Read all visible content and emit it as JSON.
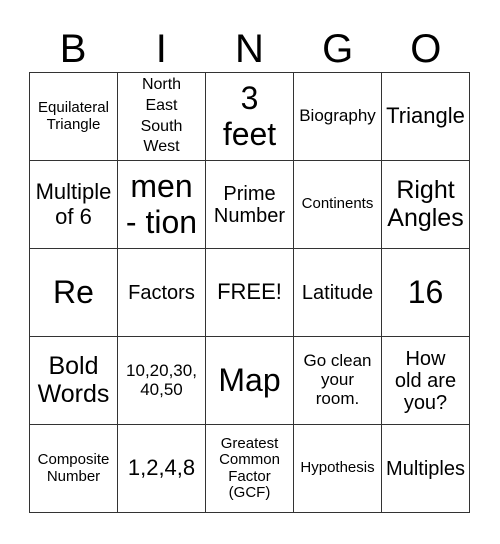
{
  "header": [
    "B",
    "I",
    "N",
    "G",
    "O"
  ],
  "rows": [
    [
      "Equilateral\nTriangle",
      "North\nEast\nSouth\nWest",
      "3\nfeet",
      "Biography",
      "Triangle"
    ],
    [
      "Multiple\nof 6",
      "men\n- tion",
      "Prime\nNumber",
      "Continents",
      "Right\nAngles"
    ],
    [
      "Re",
      "Factors",
      "FREE!",
      "Latitude",
      "16"
    ],
    [
      "Bold\nWords",
      "10,20,30,\n40,50",
      "Map",
      "Go clean\nyour\nroom.",
      "How\nold are\nyou?"
    ],
    [
      "Composite\nNumber",
      "1,2,4,8",
      "Greatest\nCommon\nFactor\n(GCF)",
      "Hypothesis",
      "Multiples"
    ]
  ]
}
